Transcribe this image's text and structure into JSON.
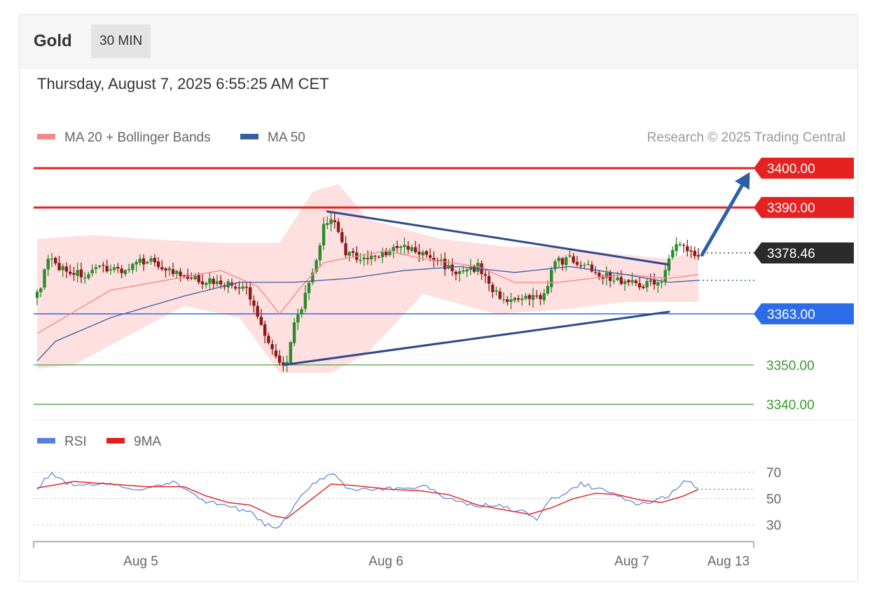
{
  "header": {
    "instrument": "Gold",
    "timeframe": "30 MIN",
    "datetime": "Thursday, August 7, 2025 6:55:25 AM CET"
  },
  "legend": {
    "ma20_bb": "MA 20 + Bollinger Bands",
    "ma50": "MA 50",
    "credit": "Research © 2025 Trading Central",
    "rsi": "RSI",
    "rsi_ma": "9MA"
  },
  "colors": {
    "resistance": "#e52222",
    "support_main": "#2b6de8",
    "support_green": "#3d9a2f",
    "bullish_candle": "#2d8a2d",
    "bearish_candle": "#8a1a1a",
    "bollinger_band": "#ffd6d6",
    "ma20": "#f28a8a",
    "ma50": "#3a5fa0",
    "triangle": "#2e4a8a",
    "arrow": "#2d5fa8",
    "last_price": "#2b2b2b",
    "rsi_line": "#5a7ee0",
    "rsi_ma_line": "#e21d1d"
  },
  "chart_data": {
    "type": "candlestick",
    "x_labels": [
      "Aug 5",
      "Aug 6",
      "Aug 7",
      "Aug 13"
    ],
    "price_levels": [
      {
        "value": 3400.0,
        "label": "3400.00",
        "kind": "resistance"
      },
      {
        "value": 3390.0,
        "label": "3390.00",
        "kind": "resistance"
      },
      {
        "value": 3378.46,
        "label": "3378.46",
        "kind": "last"
      },
      {
        "value": 3363.0,
        "label": "3363.00",
        "kind": "pivot"
      },
      {
        "value": 3350.0,
        "label": "3350.00",
        "kind": "support"
      },
      {
        "value": 3340.0,
        "label": "3340.00",
        "kind": "support"
      }
    ],
    "close_anchors": [
      [
        0,
        3367.5
      ],
      [
        3,
        3376.5
      ],
      [
        8,
        3374
      ],
      [
        14,
        3372.5
      ],
      [
        18,
        3375
      ],
      [
        24,
        3374
      ],
      [
        30,
        3377
      ],
      [
        40,
        3372
      ],
      [
        50,
        3371
      ],
      [
        57,
        3369
      ],
      [
        63,
        3356
      ],
      [
        65,
        3352
      ],
      [
        68,
        3350.5
      ],
      [
        70,
        3360
      ],
      [
        75,
        3372.5
      ],
      [
        78,
        3385
      ],
      [
        80,
        3388
      ],
      [
        84,
        3378
      ],
      [
        90,
        3377
      ],
      [
        96,
        3379
      ],
      [
        100,
        3380
      ],
      [
        105,
        3378
      ],
      [
        110,
        3376
      ],
      [
        115,
        3373
      ],
      [
        120,
        3375
      ],
      [
        125,
        3368
      ],
      [
        130,
        3366
      ],
      [
        135,
        3367
      ],
      [
        138,
        3368
      ],
      [
        141,
        3376
      ],
      [
        145,
        3377
      ],
      [
        150,
        3375
      ],
      [
        156,
        3372
      ],
      [
        162,
        3371
      ],
      [
        166,
        3370.5
      ],
      [
        170,
        3372
      ],
      [
        174,
        3381
      ],
      [
        177,
        3379
      ],
      [
        180,
        3378.5
      ]
    ],
    "candle_count": 181,
    "y_range": [
      3336,
      3403
    ],
    "ma20_anchors": [
      [
        0,
        3358
      ],
      [
        20,
        3369
      ],
      [
        50,
        3374
      ],
      [
        60,
        3370
      ],
      [
        66,
        3363
      ],
      [
        72,
        3370
      ],
      [
        78,
        3376
      ],
      [
        95,
        3379
      ],
      [
        105,
        3377
      ],
      [
        120,
        3375
      ],
      [
        130,
        3371
      ],
      [
        142,
        3371
      ],
      [
        160,
        3373
      ],
      [
        172,
        3372
      ],
      [
        180,
        3373
      ]
    ],
    "bb_upper_anchors": [
      [
        0,
        3382
      ],
      [
        15,
        3383
      ],
      [
        30,
        3382
      ],
      [
        50,
        3381
      ],
      [
        66,
        3381
      ],
      [
        75,
        3394
      ],
      [
        82,
        3396
      ],
      [
        90,
        3387
      ],
      [
        110,
        3382
      ],
      [
        128,
        3380
      ],
      [
        140,
        3380
      ],
      [
        160,
        3378
      ],
      [
        172,
        3377
      ],
      [
        180,
        3379
      ]
    ],
    "bb_lower_anchors": [
      [
        0,
        3349
      ],
      [
        10,
        3350
      ],
      [
        20,
        3355
      ],
      [
        40,
        3365
      ],
      [
        55,
        3362
      ],
      [
        66,
        3348
      ],
      [
        80,
        3348
      ],
      [
        90,
        3353
      ],
      [
        105,
        3368
      ],
      [
        125,
        3363
      ],
      [
        142,
        3364
      ],
      [
        160,
        3366
      ],
      [
        172,
        3366
      ],
      [
        180,
        3366
      ]
    ],
    "ma50_anchors": [
      [
        0,
        3351
      ],
      [
        5,
        3356
      ],
      [
        20,
        3362
      ],
      [
        40,
        3367.5
      ],
      [
        55,
        3371
      ],
      [
        70,
        3371
      ],
      [
        85,
        3372
      ],
      [
        100,
        3374
      ],
      [
        115,
        3375
      ],
      [
        130,
        3373.5
      ],
      [
        145,
        3375
      ],
      [
        160,
        3373
      ],
      [
        172,
        3371
      ],
      [
        180,
        3371.5
      ]
    ],
    "ma50_projection": {
      "from": 180,
      "to": 196,
      "value": 3371.5
    },
    "last_projection": {
      "from": 180,
      "to": 196,
      "value": 3378.46
    },
    "triangle": {
      "upper": [
        [
          79,
          3389
        ],
        [
          172,
          3375.5
        ]
      ],
      "lower": [
        [
          67,
          3350
        ],
        [
          172,
          3363.5
        ]
      ]
    },
    "arrow": {
      "from": [
        181,
        3378
      ],
      "to": [
        194,
        3399
      ]
    },
    "rsi": {
      "levels": [
        70,
        50,
        30
      ],
      "y_range": [
        25,
        75
      ],
      "last_value": 57,
      "rsi_anchors": [
        [
          0,
          58
        ],
        [
          4,
          70
        ],
        [
          8,
          62
        ],
        [
          14,
          60
        ],
        [
          20,
          61
        ],
        [
          26,
          57
        ],
        [
          32,
          60
        ],
        [
          38,
          62
        ],
        [
          42,
          54
        ],
        [
          46,
          48
        ],
        [
          52,
          44
        ],
        [
          58,
          40
        ],
        [
          62,
          30
        ],
        [
          66,
          27
        ],
        [
          70,
          45
        ],
        [
          74,
          58
        ],
        [
          78,
          66
        ],
        [
          80,
          70
        ],
        [
          84,
          58
        ],
        [
          92,
          57
        ],
        [
          100,
          58
        ],
        [
          106,
          60
        ],
        [
          110,
          52
        ],
        [
          114,
          48
        ],
        [
          120,
          45
        ],
        [
          126,
          44
        ],
        [
          132,
          40
        ],
        [
          136,
          33
        ],
        [
          140,
          50
        ],
        [
          144,
          54
        ],
        [
          148,
          62
        ],
        [
          152,
          57
        ],
        [
          156,
          55
        ],
        [
          160,
          50
        ],
        [
          164,
          45
        ],
        [
          168,
          48
        ],
        [
          172,
          52
        ],
        [
          176,
          64
        ],
        [
          180,
          58
        ]
      ],
      "ma_anchors": [
        [
          0,
          58
        ],
        [
          10,
          63
        ],
        [
          20,
          61
        ],
        [
          30,
          59
        ],
        [
          40,
          59
        ],
        [
          46,
          52
        ],
        [
          52,
          47
        ],
        [
          58,
          45
        ],
        [
          64,
          37
        ],
        [
          68,
          35
        ],
        [
          74,
          48
        ],
        [
          80,
          61
        ],
        [
          86,
          60
        ],
        [
          96,
          57
        ],
        [
          104,
          56
        ],
        [
          112,
          53
        ],
        [
          120,
          45
        ],
        [
          128,
          41
        ],
        [
          134,
          38
        ],
        [
          140,
          43
        ],
        [
          146,
          50
        ],
        [
          152,
          54
        ],
        [
          158,
          53
        ],
        [
          164,
          49
        ],
        [
          170,
          47
        ],
        [
          176,
          52
        ],
        [
          180,
          57
        ]
      ]
    }
  }
}
